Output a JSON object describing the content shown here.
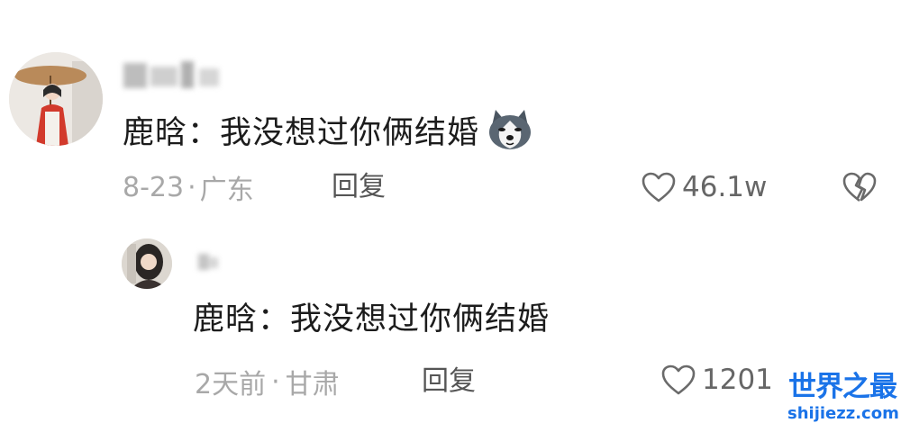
{
  "comments": [
    {
      "text": "鹿晗：我没想过你俩结婚",
      "emoji_icon": "husky-dog-emoji",
      "date": "8-23",
      "location": "广东",
      "reply_label": "回复",
      "likes": "46.1w"
    },
    {
      "text": "鹿晗：我没想过你俩结婚",
      "date": "2天前",
      "location": "甘肃",
      "reply_label": "回复",
      "likes": "1201"
    }
  ],
  "watermark": {
    "title": "世界之最",
    "url": "shijiezz.com",
    "color": "#1a73e8"
  }
}
